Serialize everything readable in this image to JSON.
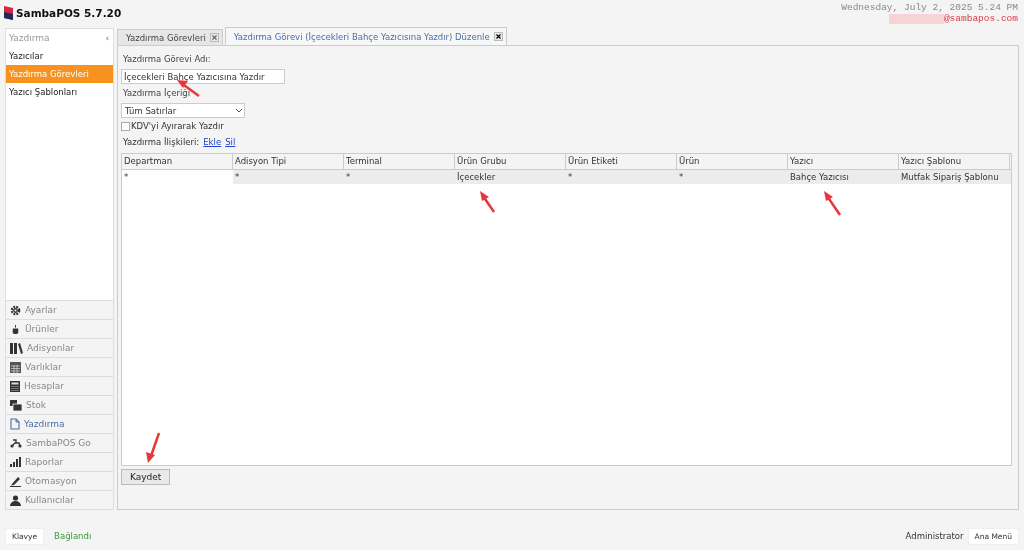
{
  "app": {
    "title": "SambaPOS 5.7.20",
    "date": "Wednesday, July 2, 2025 5.24 PM",
    "email": "@sambapos.com"
  },
  "sidebar": {
    "title": "Yazdırma",
    "collapse": "‹",
    "items": [
      {
        "label": "Yazıcılar",
        "selected": false
      },
      {
        "label": "Yazdırma Görevleri",
        "selected": true
      },
      {
        "label": "Yazıcı Şablonları",
        "selected": false
      }
    ],
    "nav": [
      {
        "label": "Ayarlar",
        "selected": false
      },
      {
        "label": "Ürünler",
        "selected": false
      },
      {
        "label": "Adisyonlar",
        "selected": false
      },
      {
        "label": "Varlıklar",
        "selected": false
      },
      {
        "label": "Hesaplar",
        "selected": false
      },
      {
        "label": "Stok",
        "selected": false
      },
      {
        "label": "Yazdırma",
        "selected": true
      },
      {
        "label": "SambaPOS Go",
        "selected": false
      },
      {
        "label": "Raporlar",
        "selected": false
      },
      {
        "label": "Otomasyon",
        "selected": false
      },
      {
        "label": "Kullanıcılar",
        "selected": false
      }
    ]
  },
  "tabs": [
    {
      "label": "Yazdırma Görevleri",
      "selected": false
    },
    {
      "label": "Yazdırma Görevi (İçecekleri Bahçe Yazıcısına Yazdır) Düzenle",
      "selected": true
    }
  ],
  "form": {
    "name_label": "Yazdırma Görevi Adı:",
    "name_value": "İçecekleri Bahçe Yazıcısına Yazdır",
    "content_label": "Yazdırma İçeriği",
    "content_value": "Tüm Satırlar",
    "vat_checkbox": {
      "label": "KDV'yi Ayırarak Yazdır",
      "checked": false
    },
    "relations_label": "Yazdırma İlişkileri:",
    "add_link": "Ekle",
    "delete_link": "Sil"
  },
  "table": {
    "columns": [
      "Departman",
      "Adisyon Tipi",
      "Terminal",
      "Ürün Grubu",
      "Ürün Etiketi",
      "Ürün",
      "Yazıcı",
      "Yazıcı Şablonu"
    ],
    "rows": [
      {
        "selected": true,
        "cells": [
          "*",
          "*",
          "*",
          "İçecekler",
          "*",
          "*",
          "Bahçe Yazıcısı",
          "Mutfak Sipariş Şablonu"
        ]
      }
    ]
  },
  "save_button": "Kaydet",
  "status_bar": {
    "keyboard_button": "Klavye",
    "connection": "Bağlandı",
    "user": "Administrator",
    "main_menu_button": "Ana Menü"
  }
}
